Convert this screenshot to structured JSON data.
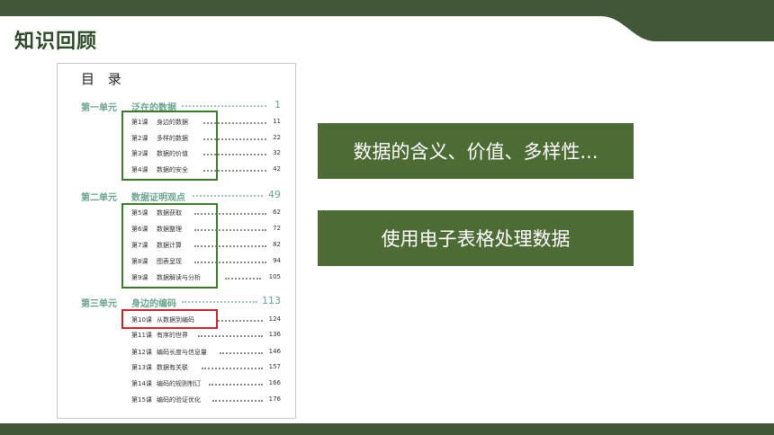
{
  "slide": {
    "title": "知识回顾"
  },
  "colors": {
    "band": "#415737",
    "callout": "#4d6b35",
    "unit_text": "#6aa48c",
    "highlight_green": "#3d7a2c",
    "highlight_red": "#c8232c"
  },
  "toc": {
    "heading": "目 录",
    "units": [
      {
        "label": "第一单元",
        "title": "泛在的数据",
        "page": "1"
      },
      {
        "label": "第二单元",
        "title": "数据证明观点",
        "page": "49"
      },
      {
        "label": "第三单元",
        "title": "身边的编码",
        "page": "113"
      }
    ],
    "lessons": [
      {
        "label": "第1课",
        "title": "身边的数据",
        "page": "11"
      },
      {
        "label": "第2课",
        "title": "多样的数据",
        "page": "22"
      },
      {
        "label": "第3课",
        "title": "数据的价值",
        "page": "32"
      },
      {
        "label": "第4课",
        "title": "数据的安全",
        "page": "42"
      },
      {
        "label": "第5课",
        "title": "数据获取",
        "page": "62"
      },
      {
        "label": "第6课",
        "title": "数据整理",
        "page": "72"
      },
      {
        "label": "第7课",
        "title": "数据计算",
        "page": "82"
      },
      {
        "label": "第8课",
        "title": "图表呈现",
        "page": "94"
      },
      {
        "label": "第9课",
        "title": "数据解读与分析",
        "page": "105"
      },
      {
        "label": "第10课",
        "title": "从数据到编码",
        "page": "124"
      },
      {
        "label": "第11课",
        "title": "有序的世界",
        "page": "136"
      },
      {
        "label": "第12课",
        "title": "编码长度与信息量",
        "page": "146"
      },
      {
        "label": "第13课",
        "title": "数据有关联",
        "page": "157"
      },
      {
        "label": "第14课",
        "title": "编码的规则制订",
        "page": "166"
      },
      {
        "label": "第15课",
        "title": "编码的验证优化",
        "page": "176"
      }
    ]
  },
  "callouts": [
    {
      "text": "数据的含义、价值、多样性..."
    },
    {
      "text": "使用电子表格处理数据"
    }
  ]
}
